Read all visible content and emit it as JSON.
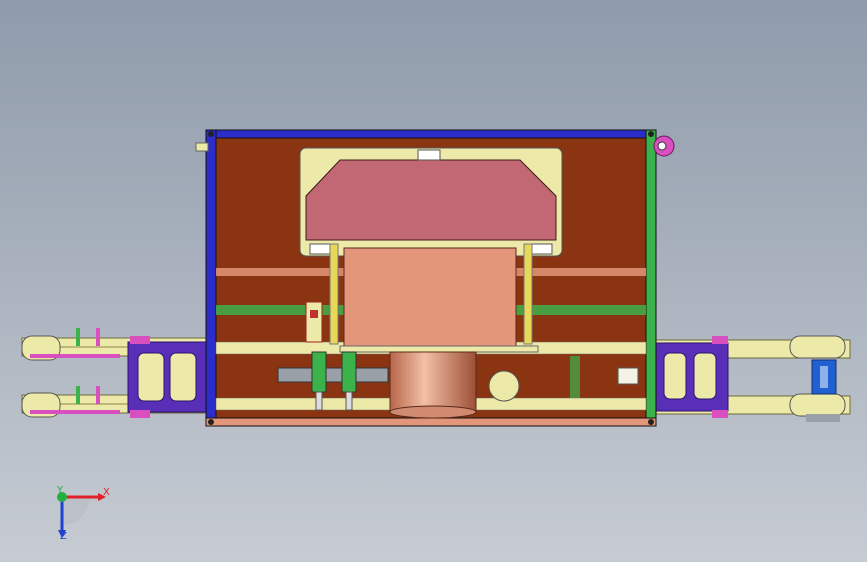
{
  "viewport": {
    "background_top": "#8f9bab",
    "background_bottom": "#c7ccd3"
  },
  "model": {
    "frame_color": "#2c2cc8",
    "panel_color": "#8a3412",
    "accent_colors": [
      "#c26774",
      "#e3967a",
      "#ede9a8",
      "#5a2fb8",
      "#d94fc0",
      "#3cb24a"
    ]
  },
  "triad": {
    "x_label": "X",
    "y_label": "Y",
    "z_label": "Z",
    "x_color": "#e0202a",
    "y_color": "#22b040",
    "z_color": "#2040d0"
  }
}
